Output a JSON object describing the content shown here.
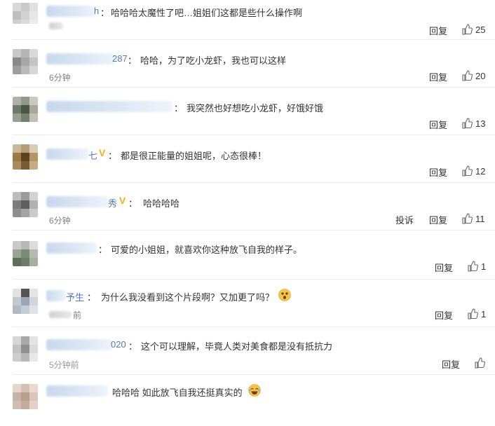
{
  "reply_label": "回复",
  "report_label": "投诉",
  "comments": [
    {
      "name_tail": "h",
      "text": "哈哈哈太魔性了吧…姐姐们这都是些什么操作啊",
      "time": "",
      "likes": "25"
    },
    {
      "name_tail": "287",
      "text": "哈哈，为了吃小龙虾，我也可以这样",
      "time": "6分钟",
      "likes": "20"
    },
    {
      "name_tail": "",
      "text": "我突然也好想吃小龙虾，好饿好饿",
      "time": "",
      "likes": "13"
    },
    {
      "name_tail": "七",
      "text": "都是很正能量的姐姐呢，心态很棒！",
      "time": "",
      "likes": "12"
    },
    {
      "name_tail": "秀",
      "text": "哈哈哈哈",
      "time": "6分钟",
      "likes": "11"
    },
    {
      "name_tail": "",
      "text": "可爱的小姐姐，就喜欢你这种放飞自我的样子。",
      "time": "",
      "likes": "1"
    },
    {
      "name_tail": "予生",
      "text": "为什么我没看到这个片段啊？又加更了吗？",
      "time": "前",
      "likes": "1"
    },
    {
      "name_tail": "020",
      "text": "这个可以理解，毕竟人类对美食都是没有抵抗力",
      "time": "5分钟前",
      "likes": ""
    },
    {
      "name_tail": "",
      "text": "哈哈哈 如此放飞自我还挺真实的",
      "time": "",
      "likes": ""
    }
  ]
}
